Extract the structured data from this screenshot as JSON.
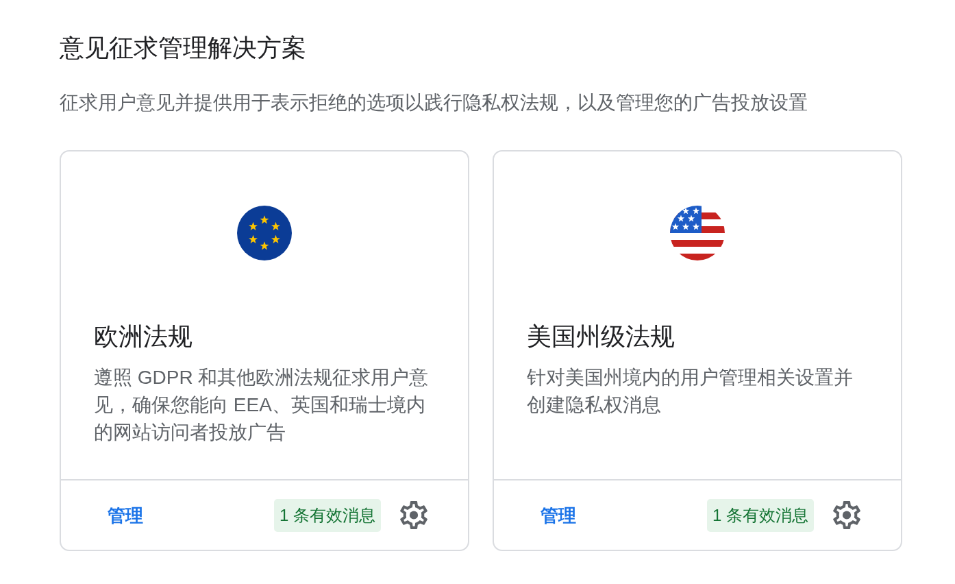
{
  "header": {
    "title": "意见征求管理解决方案",
    "description": "征求用户意见并提供用于表示拒绝的选项以践行隐私权法规，以及管理您的广告投放设置"
  },
  "cards": [
    {
      "kind": "eu",
      "title": "欧洲法规",
      "description": "遵照 GDPR 和其他欧洲法规征求用户意见，确保您能向 EEA、英国和瑞士境内的网站访问者投放广告",
      "action": "管理",
      "badge": "1 条有效消息"
    },
    {
      "kind": "us",
      "title": "美国州级法规",
      "description": "针对美国州境内的用户管理相关设置并创建隐私权消息",
      "action": "管理",
      "badge": "1 条有效消息"
    }
  ]
}
